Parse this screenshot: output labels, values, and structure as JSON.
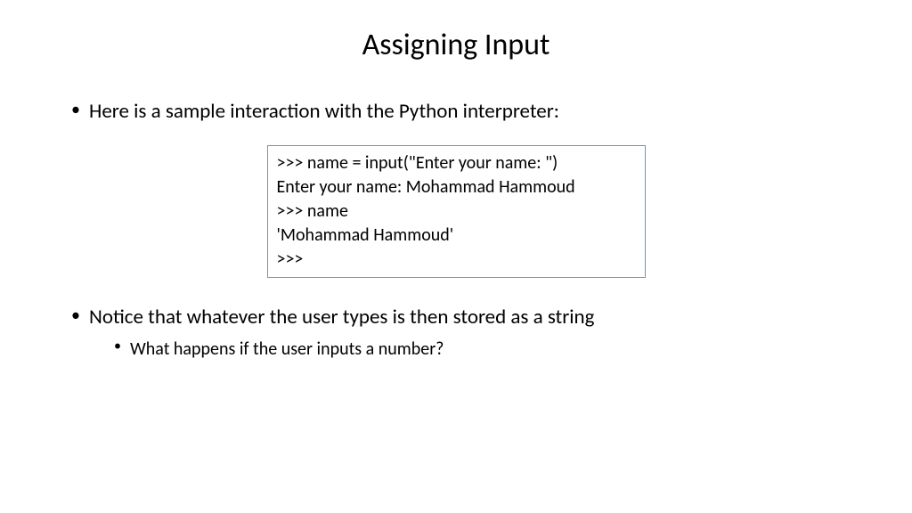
{
  "slide": {
    "title": "Assigning Input",
    "bullets": [
      {
        "text": "Here is a sample interaction with the Python interpreter:"
      },
      {
        "text": "Notice that whatever the user types is then stored as a string",
        "sub": [
          "What happens if the user inputs a number?"
        ]
      }
    ],
    "code": {
      "lines": [
        ">>> name = input(\"Enter your name: \")",
        "Enter your name: Mohammad Hammoud",
        ">>> name",
        "'Mohammad Hammoud'",
        ">>>"
      ]
    }
  }
}
